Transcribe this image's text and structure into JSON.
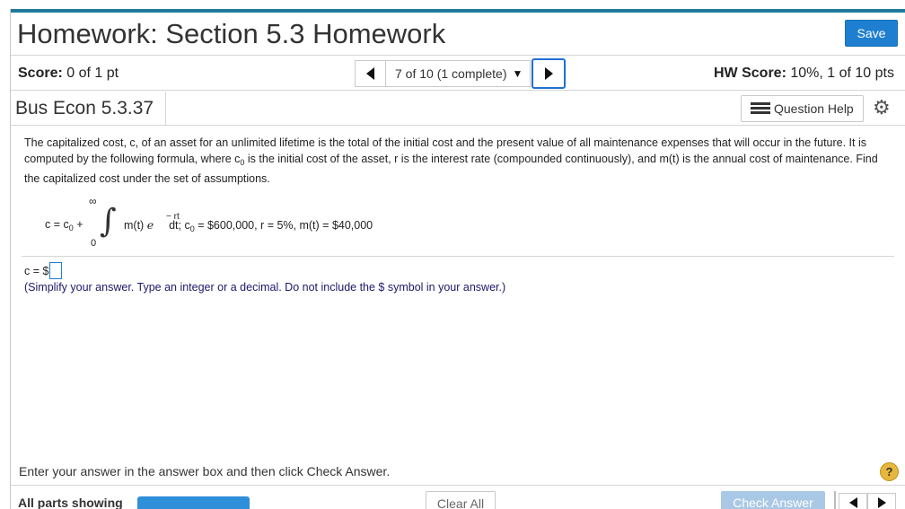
{
  "header": {
    "title": "Homework: Section 5.3 Homework",
    "save_label": "Save"
  },
  "score_bar": {
    "score_label": "Score:",
    "score_value": "0 of 1 pt",
    "question_nav": "7 of 10 (1 complete)",
    "hw_score_label": "HW Score:",
    "hw_score_value": "10%, 1 of 10 pts"
  },
  "question": {
    "id": "Bus Econ 5.3.37",
    "help_label": "Question Help",
    "statement_1": "The capitalized cost, c, of an asset for an unlimited lifetime is the total of the initial cost and the present value of all maintenance expenses that will occur in the future. It is computed by the following formula, where c",
    "statement_sub": "0",
    "statement_2": " is the initial cost of the asset, r is the interest rate (compounded continuously), and m(t) is the annual cost of maintenance. Find the capitalized cost under the set of assumptions.",
    "formula": {
      "lhs": "c = c",
      "lhs_sub": "0",
      "plus": " +",
      "upper_limit": "∞",
      "lower_limit": "0",
      "integrand": "m(t) ",
      "e": "e",
      "exponent": "− rt",
      "rest_1": "dt; c",
      "rest_sub": "0",
      "rest_2": " = $600,000, r = 5%, m(t) = $40,000"
    },
    "answer_prefix": "c = $",
    "instructions": "(Simplify your answer. Type an integer or a decimal. Do not include the $ symbol in your answer.)"
  },
  "footer": {
    "hint": "Enter your answer in the answer box and then click Check Answer.",
    "help_symbol": "?",
    "parts_label": "All parts showing",
    "clear_label": "Clear All",
    "check_label": "Check Answer"
  },
  "colors": {
    "accent": "#1e7fd0",
    "top_bar": "#1f7a9c",
    "check_disabled": "#a9c8e6",
    "help_circle": "#e6b73c"
  }
}
